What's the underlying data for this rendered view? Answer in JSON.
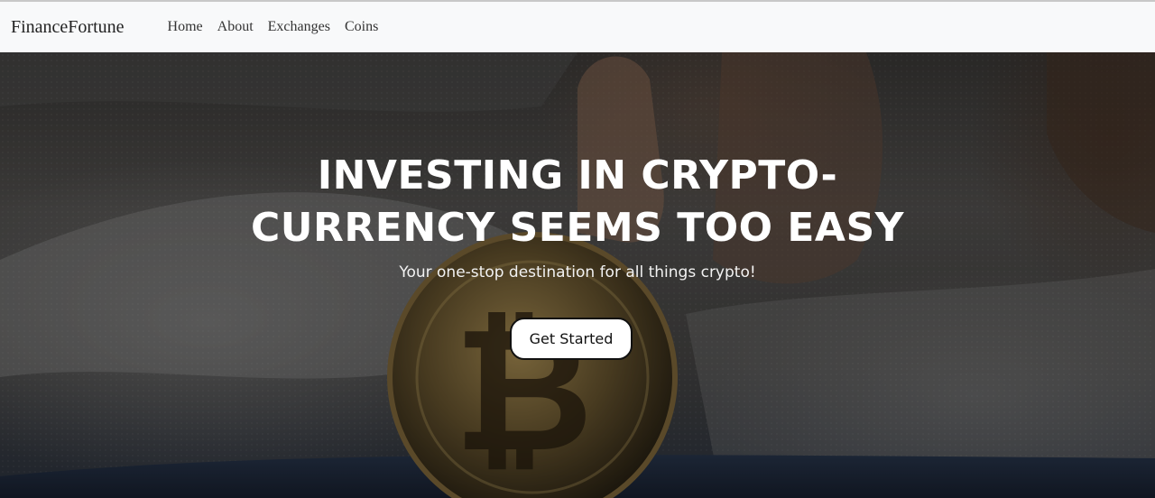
{
  "navbar": {
    "brand": "FinanceFortune",
    "links": [
      {
        "label": "Home"
      },
      {
        "label": "About"
      },
      {
        "label": "Exchanges"
      },
      {
        "label": "Coins"
      }
    ]
  },
  "hero": {
    "headline": "INVESTING IN CRYPTO-CURRENCY SEEMS TOO EASY",
    "subtitle": "Your one-stop destination for all things crypto!",
    "cta_label": "Get Started",
    "image": "hand-placing-bitcoin-coin-into-jeans-pocket",
    "overlay_color": "#000000"
  }
}
